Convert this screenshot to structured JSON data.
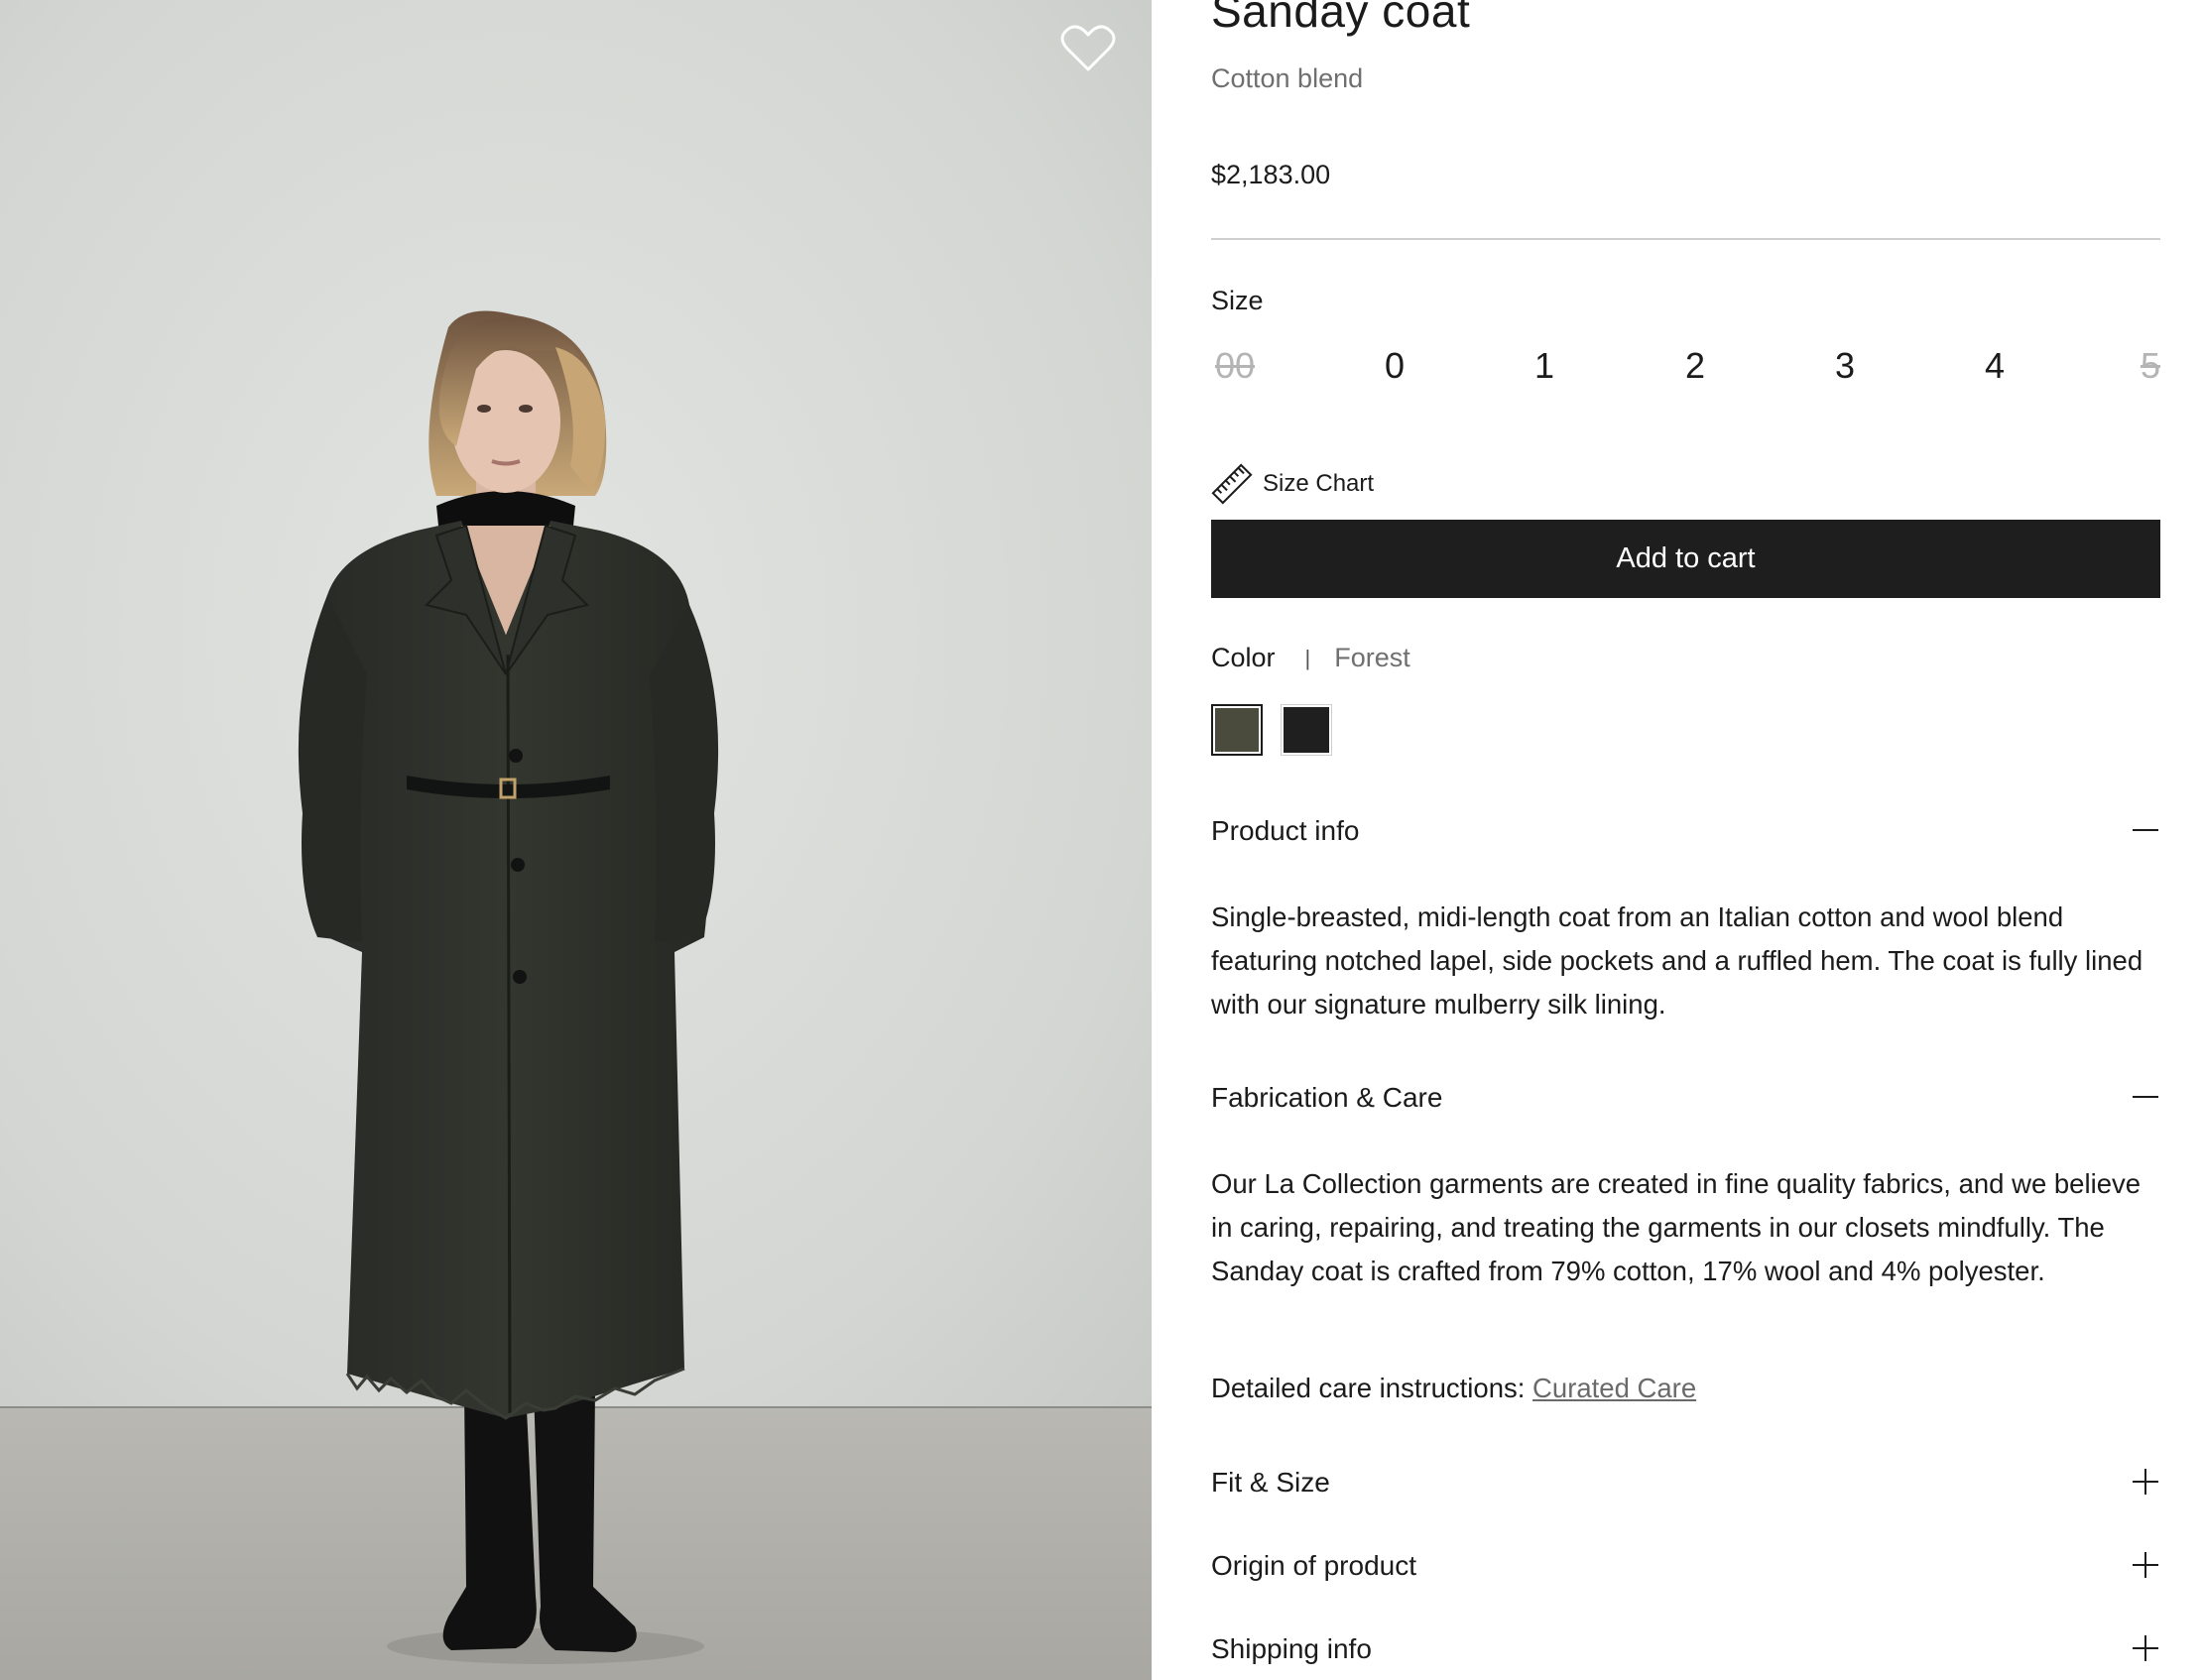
{
  "product": {
    "title": "Sanday coat",
    "subtitle": "Cotton blend",
    "price": "$2,183.00"
  },
  "wishlist": {
    "icon": "heart-outline-icon"
  },
  "size": {
    "label": "Size",
    "options": [
      {
        "label": "00",
        "available": false
      },
      {
        "label": "0",
        "available": true
      },
      {
        "label": "1",
        "available": true
      },
      {
        "label": "2",
        "available": true
      },
      {
        "label": "3",
        "available": true
      },
      {
        "label": "4",
        "available": true
      },
      {
        "label": "5",
        "available": false
      }
    ],
    "chart_label": "Size Chart",
    "chart_icon": "ruler-icon"
  },
  "cart": {
    "label": "Add to cart"
  },
  "color": {
    "label": "Color",
    "separator": "|",
    "selected": "Forest",
    "swatches": [
      {
        "name": "Forest",
        "hex": "#4a4b3c",
        "selected": true
      },
      {
        "name": "Black",
        "hex": "#1f1f1f",
        "selected": false
      }
    ]
  },
  "accordion": {
    "product_info": {
      "label": "Product info",
      "expanded": true,
      "body": "Single-breasted, midi-length coat from an Italian cotton and wool blend featuring notched lapel, side pockets and a ruffled hem. The coat is fully lined with our signature mulberry silk lining."
    },
    "fabrication": {
      "label": "Fabrication & Care",
      "expanded": true,
      "body": "Our La Collection garments are created in fine quality fabrics, and we believe in caring, repairing, and treating the garments in our closets mindfully. The Sanday coat is crafted from 79% cotton, 17% wool and 4% polyester.",
      "care_prefix": "Detailed care instructions:",
      "care_link": "Curated Care"
    },
    "fit": {
      "label": "Fit & Size",
      "expanded": false
    },
    "origin": {
      "label": "Origin of product",
      "expanded": false
    },
    "shipping": {
      "label": "Shipping info",
      "expanded": false
    }
  },
  "colors": {
    "button_bg": "#1e1e1e",
    "muted_text": "#6f6f6f",
    "unavailable": "#b4b4b4"
  }
}
